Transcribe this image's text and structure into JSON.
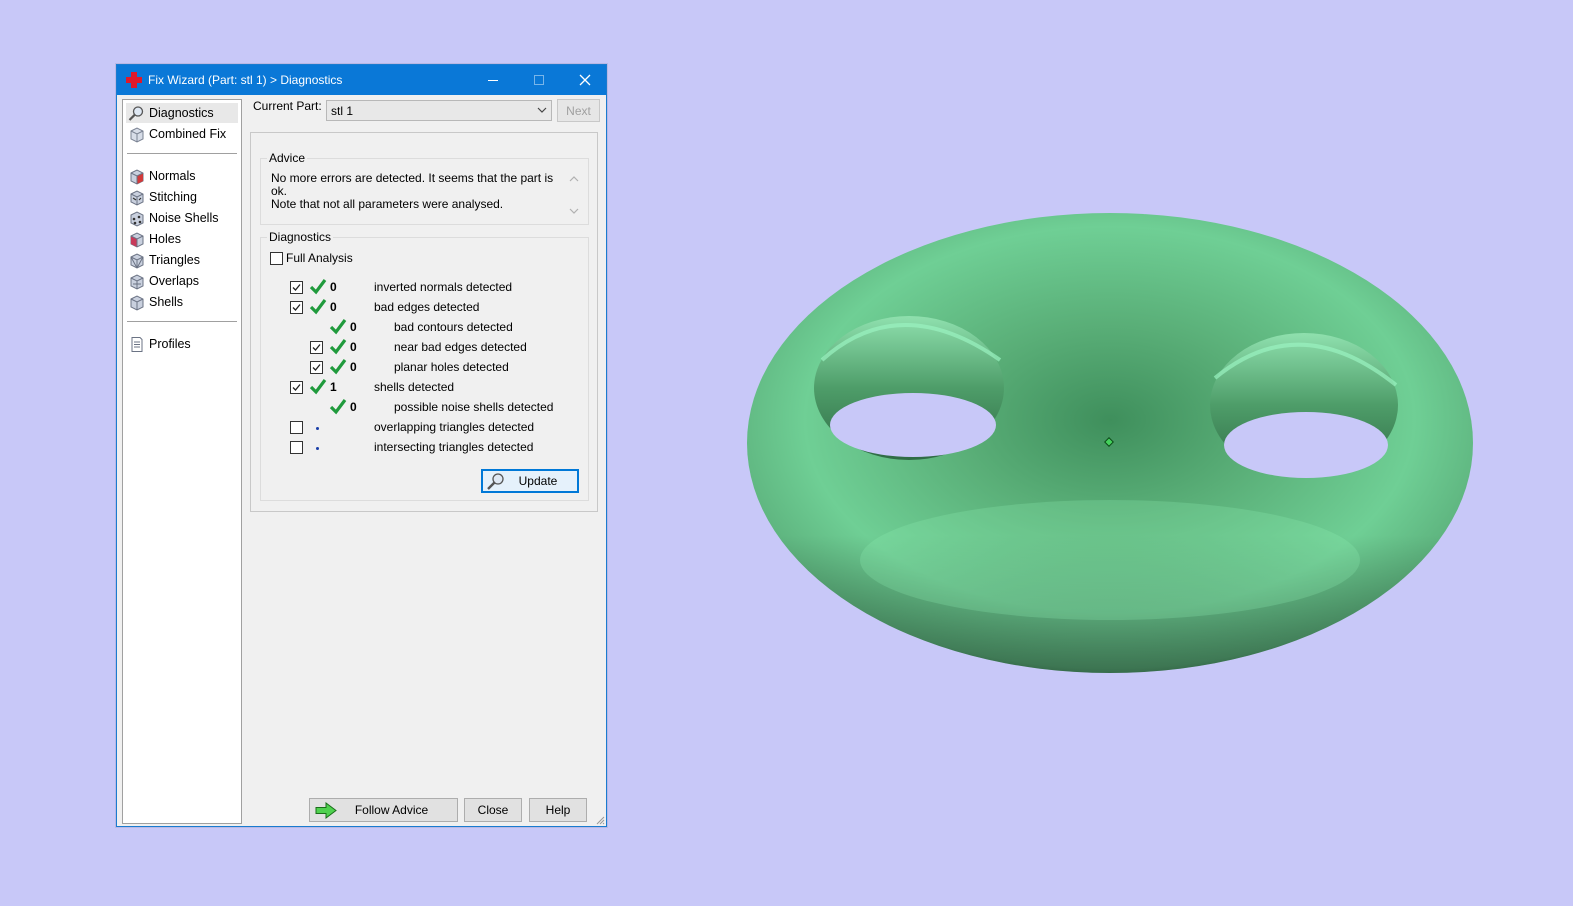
{
  "window": {
    "title": "Fix Wizard (Part: stl 1) > Diagnostics"
  },
  "nav": {
    "items": [
      {
        "label": "Diagnostics",
        "icon": "magnifier-icon"
      },
      {
        "label": "Combined Fix",
        "icon": "cube-icon"
      },
      {
        "label": "Normals",
        "icon": "normals-cube-icon"
      },
      {
        "label": "Stitching",
        "icon": "stitching-cube-icon"
      },
      {
        "label": "Noise Shells",
        "icon": "noise-shells-cube-icon"
      },
      {
        "label": "Holes",
        "icon": "holes-cube-icon"
      },
      {
        "label": "Triangles",
        "icon": "triangles-cube-icon"
      },
      {
        "label": "Overlaps",
        "icon": "overlaps-cube-icon"
      },
      {
        "label": "Shells",
        "icon": "shells-cube-icon"
      },
      {
        "label": "Profiles",
        "icon": "document-icon"
      }
    ],
    "selected": "Diagnostics"
  },
  "current_part": {
    "label": "Current Part:",
    "value": "stl 1",
    "next_label": "Next"
  },
  "advice": {
    "title": "Advice",
    "line1": "No more errors are detected. It seems that the part is ok.",
    "line2": "Note that not all parameters were analysed."
  },
  "diagnostics": {
    "title": "Diagnostics",
    "full_analysis_label": "Full Analysis",
    "full_analysis_checked": false,
    "rows": [
      {
        "checked": true,
        "count": "0",
        "label": "inverted normals detected"
      },
      {
        "checked": true,
        "count": "0",
        "label": "bad edges detected"
      },
      {
        "count": "0",
        "label": "bad contours detected"
      },
      {
        "checked": true,
        "count": "0",
        "label": "near bad edges detected"
      },
      {
        "checked": true,
        "count": "0",
        "label": "planar holes detected"
      },
      {
        "checked": true,
        "count": "1",
        "label": "shells detected"
      },
      {
        "count": "0",
        "label": "possible noise shells detected"
      },
      {
        "checked": false,
        "label": "overlapping triangles detected"
      },
      {
        "checked": false,
        "label": "intersecting triangles detected"
      }
    ],
    "update_label": "Update"
  },
  "footer": {
    "follow_advice_label": "Follow Advice",
    "close_label": "Close",
    "help_label": "Help"
  },
  "colors": {
    "title_bar": "#0a78d7",
    "background": "#c8c8f8",
    "check_green": "#1f9a3c",
    "model_green": "#6fcf95"
  }
}
